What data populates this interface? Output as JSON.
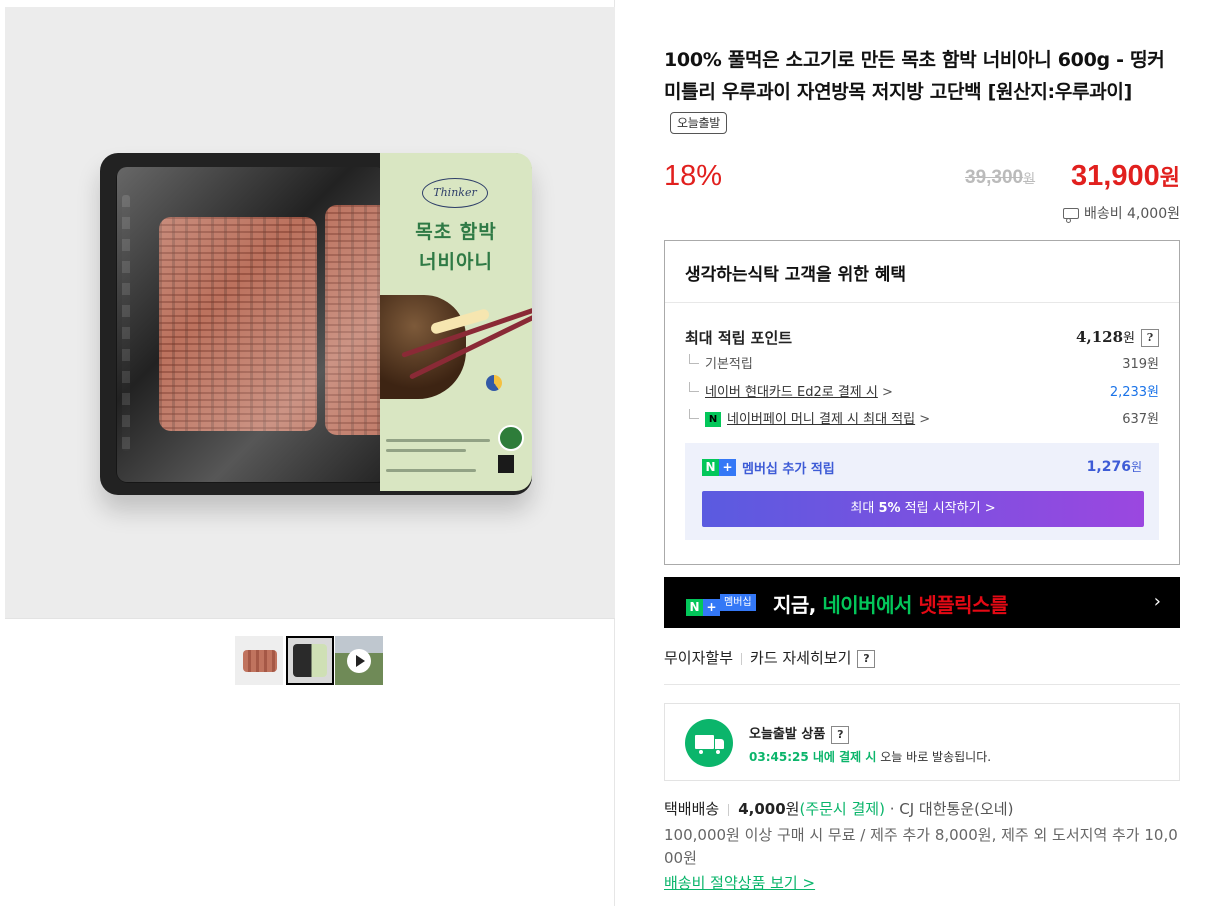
{
  "gallery": {
    "brand": "Thinker",
    "package_title_line1": "목초 함박",
    "package_title_line2": "너비아니",
    "thumbnails": [
      "thumbnail-1",
      "thumbnail-2",
      "thumbnail-video"
    ]
  },
  "product": {
    "title": "100% 풀먹은 소고기로 만든 목초 함박 너비아니 600g - 띵커미틀리 우루과이 자연방목 저지방 고단백 [원산지:우루과이]",
    "today_tag": "오늘출발",
    "discount": "18%",
    "original_price": "39,300",
    "original_price_unit": "원",
    "sale_price": "31,900",
    "sale_price_unit": "원",
    "shipping_fee": "배송비 4,000원"
  },
  "benefits": {
    "heading": "생각하는식탁 고객을 위한 혜택",
    "max_points_label": "최대 적립 포인트",
    "max_points_value": "4,128",
    "max_points_unit": "원",
    "help": "?",
    "base_label": "기본적립",
    "base_value": "319원",
    "card_label": "네이버 현대카드 Ed2로 결제 시",
    "card_value": "2,233원",
    "pay_icon": "N",
    "pay_label": "네이버페이 머니 결제 시 최대 적립",
    "pay_value": "637원",
    "chevron": ">",
    "membership": {
      "n": "N",
      "plus": "+",
      "label": "멤버십 추가 적립",
      "value": "1,276",
      "unit": "원",
      "button_prefix": "최대",
      "button_bold": "5%",
      "button_suffix": "적립 시작하기 >"
    }
  },
  "promo": {
    "badge": "멤버십",
    "text_prefix": "지금,",
    "text_green": "네이버에서",
    "text_red": "넷플릭스를",
    "arrow": "›"
  },
  "installment": {
    "interest_free": "무이자할부",
    "card_detail": "카드 자세히보기",
    "help": "?"
  },
  "today_shipping": {
    "title": "오늘출발 상품",
    "help": "?",
    "deadline": "03:45:25 내에 결제 시",
    "rest": "오늘 바로 발송됩니다."
  },
  "delivery": {
    "method": "택배배송",
    "price": "4,000",
    "price_unit": "원",
    "note": "(주문시 결제)",
    "carrier": "· CJ 대한통운(오네)",
    "info": "100,000원 이상 구매 시 무료 / 제주 추가 8,000원, 제주 외 도서지역 추가 10,000원",
    "link": "배송비 절약상품 보기 >"
  }
}
